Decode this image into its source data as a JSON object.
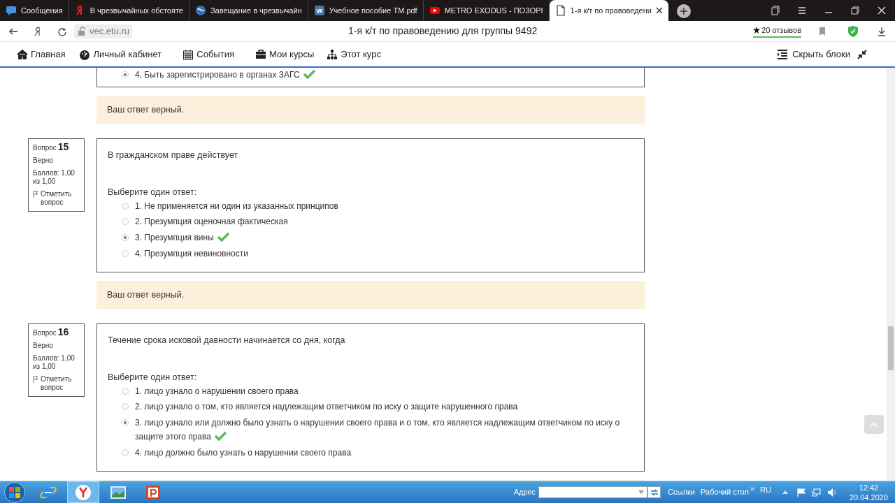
{
  "browser_tabs": [
    {
      "label": "Сообщения",
      "selected": false
    },
    {
      "label": "В чрезвычайных обстояте",
      "selected": false
    },
    {
      "label": "Завещание в чрезвычайн",
      "selected": false
    },
    {
      "label": "Учебное пособие ТМ.pdf",
      "selected": false
    },
    {
      "label": "METRO EXODUS - ПОЗОРІ",
      "selected": false
    },
    {
      "label": "1-я к/т по правоведени",
      "selected": true
    }
  ],
  "address_bar": {
    "url": "vec.etu.ru",
    "page_title": "1-я к/т по правоведению для группы 9492",
    "reviews": "20 отзывов"
  },
  "nav": {
    "items": [
      {
        "label": "Главная"
      },
      {
        "label": "Личный кабинет"
      },
      {
        "label": "События"
      },
      {
        "label": "Мои курсы"
      },
      {
        "label": "Этот курс"
      }
    ],
    "hide_blocks": "Скрыть блоки"
  },
  "previous_question": {
    "options": [
      {
        "label": "4. Быть зарегистрировано в органах ЗАГС",
        "selected": true,
        "correct": true
      }
    ],
    "feedback": "Ваш ответ верный."
  },
  "questions": [
    {
      "label": "Вопрос",
      "number": "15",
      "state": "Верно",
      "marks": "Баллов: 1,00 из 1,00",
      "flag": "Отметить вопрос",
      "text": "В гражданском праве действует",
      "prompt": "Выберите один ответ:",
      "options": [
        {
          "label": "1. Не применяется ни один из указанных принципов",
          "selected": false,
          "correct": false
        },
        {
          "label": "2. Презумпция оценочная фактическая",
          "selected": false,
          "correct": false
        },
        {
          "label": "3. Презумпция вины",
          "selected": true,
          "correct": true
        },
        {
          "label": "4. Презумпция невиновности",
          "selected": false,
          "correct": false
        }
      ],
      "feedback": "Ваш ответ верный."
    },
    {
      "label": "Вопрос",
      "number": "16",
      "state": "Верно",
      "marks": "Баллов: 1,00 из 1,00",
      "flag": "Отметить вопрос",
      "text": "Течение срока исковой давности начинается со дня, когда",
      "prompt": "Выберите один ответ:",
      "options": [
        {
          "label": "1. лицо узнало о нарушении своего права",
          "selected": false,
          "correct": false
        },
        {
          "label": "2. лицо узнало о том, кто является надлежащим ответчиком по иску о защите нарушенного права",
          "selected": false,
          "correct": false
        },
        {
          "label": "3. лицо узнало или должно было узнать о нарушении своего права и о том, кто является надлежащим ответчиком по иску о защите этого права",
          "selected": true,
          "correct": true
        },
        {
          "label": "4. лицо должно было узнать о нарушении своего права",
          "selected": false,
          "correct": false
        }
      ]
    }
  ],
  "taskbar": {
    "apps": [
      {
        "active": false
      },
      {
        "active": true
      },
      {
        "active": false
      },
      {
        "active": false
      }
    ],
    "address_label": "Адрес",
    "links": "Ссылки",
    "desktop": "Рабочий стол",
    "more": "»",
    "language": "RU",
    "time": "12:42",
    "date": "20.04.2020"
  }
}
